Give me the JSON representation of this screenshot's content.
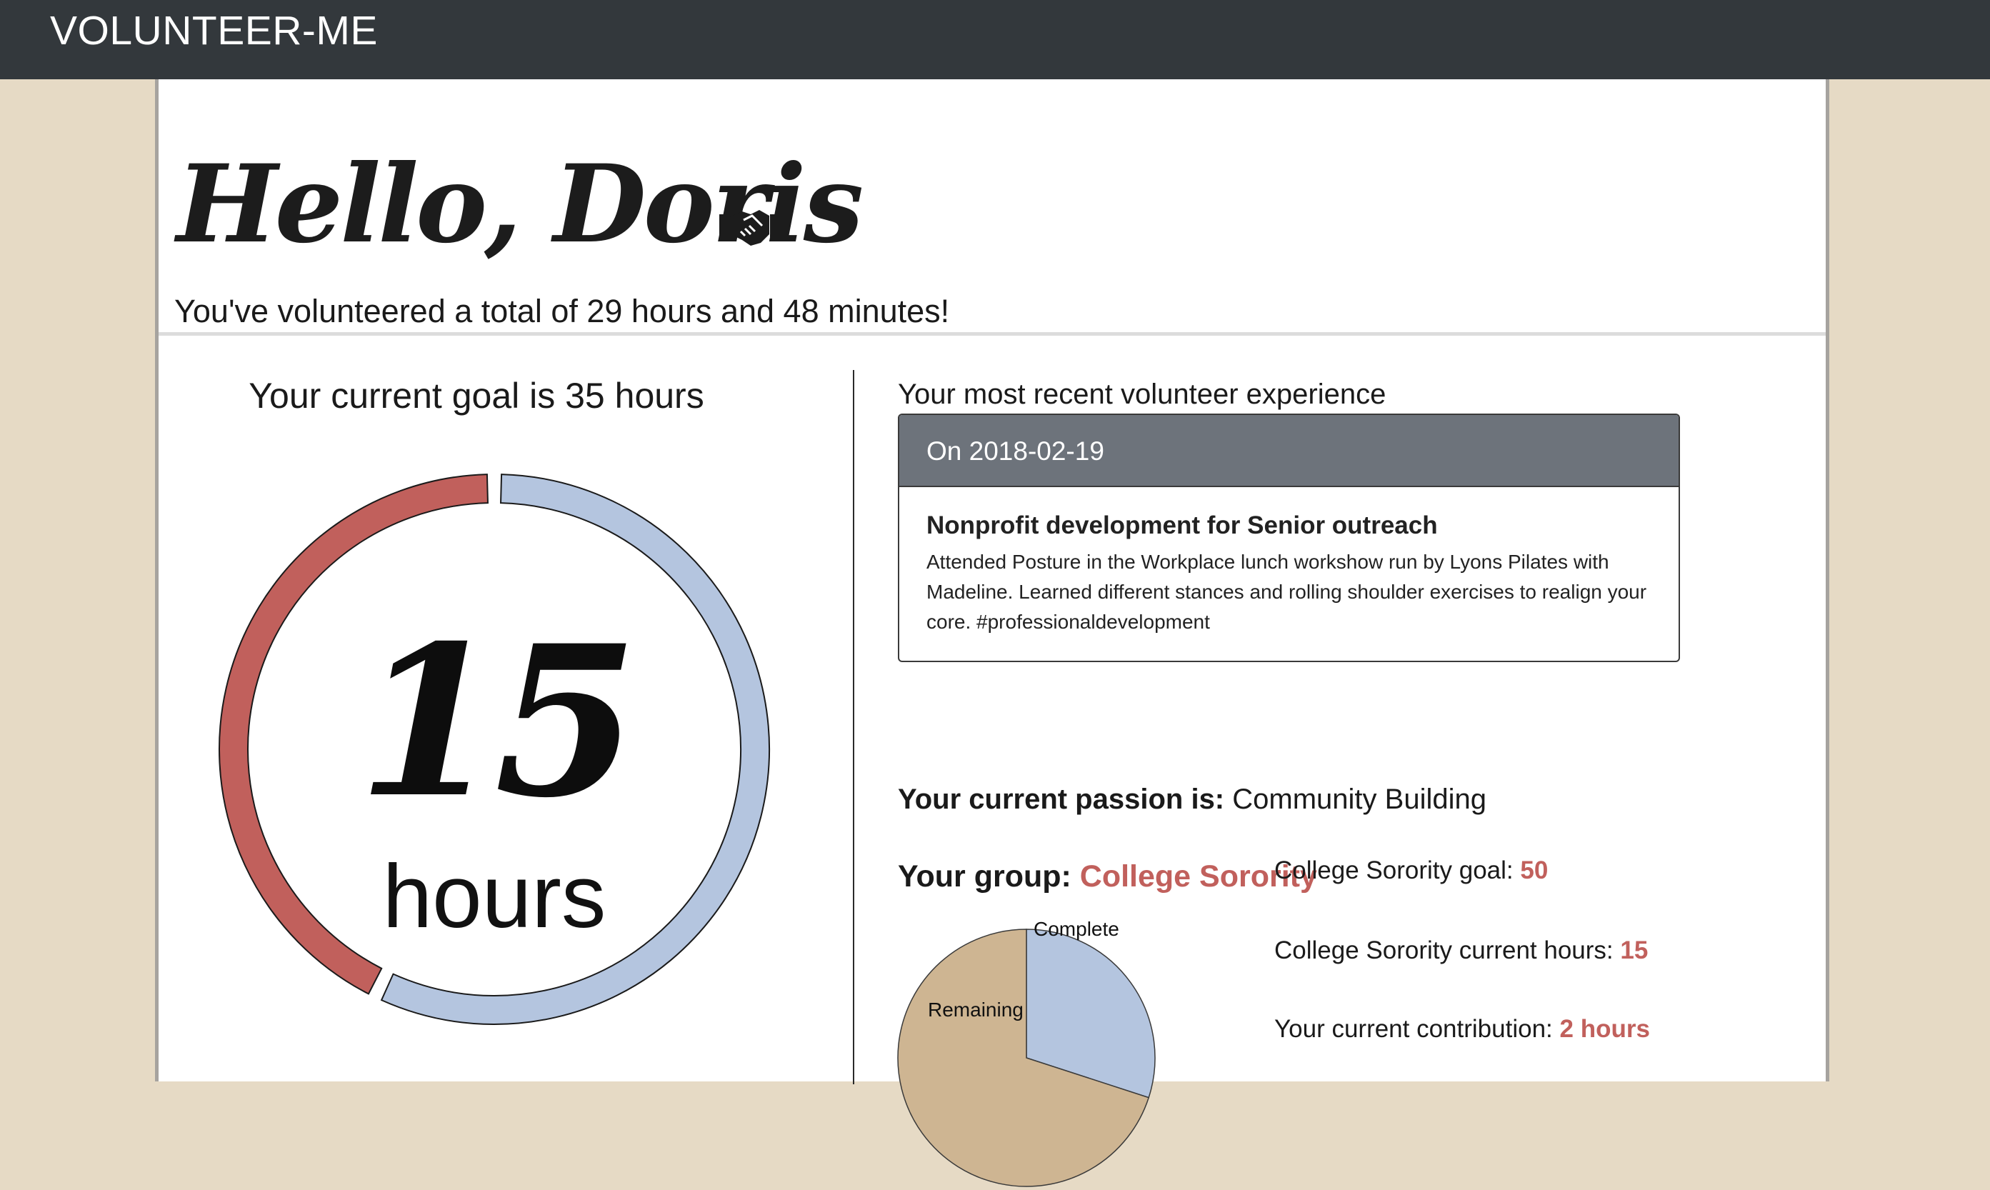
{
  "app": {
    "brand": "VOLUNTEER-ME"
  },
  "colors": {
    "accent": "#c1605c",
    "progress": "#c1605c",
    "remaining": "#b4c5df",
    "pie_complete": "#b4c5df",
    "pie_remaining": "#ceb592",
    "navbar": "#33383c",
    "page_bg": "#e6dac5"
  },
  "header": {
    "greeting": "Hello, Doris",
    "greeting_icon": "handshake-icon",
    "total_text": "You've volunteered a total of 29 hours and 48 minutes!"
  },
  "goal": {
    "title": "Your current goal is 35 hours",
    "current_number": "15",
    "current_unit": "hours",
    "progress_hours": 15,
    "goal_hours": 35
  },
  "recent": {
    "label": "Your most recent volunteer experience",
    "date_header": "On 2018-02-19",
    "title": "Nonprofit development for Senior outreach",
    "description": "Attended Posture in the Workplace lunch workshow run by Lyons Pilates with Madeline. Learned different stances and rolling shoulder exercises to realign your core. #professionaldevelopment"
  },
  "passion": {
    "label": "Your current passion is:",
    "value": "Community Building"
  },
  "group": {
    "label": "Your group:",
    "name": "College Sorority",
    "goal_label": "College Sorority goal:",
    "goal_value": "50",
    "current_label": "College Sorority current hours:",
    "current_value": "15",
    "contribution_label": "Your current contribution:",
    "contribution_value": "2 hours",
    "pie": {
      "complete_label": "Complete",
      "remaining_label": "Remaining",
      "complete_value": 15,
      "total_value": 50
    }
  }
}
